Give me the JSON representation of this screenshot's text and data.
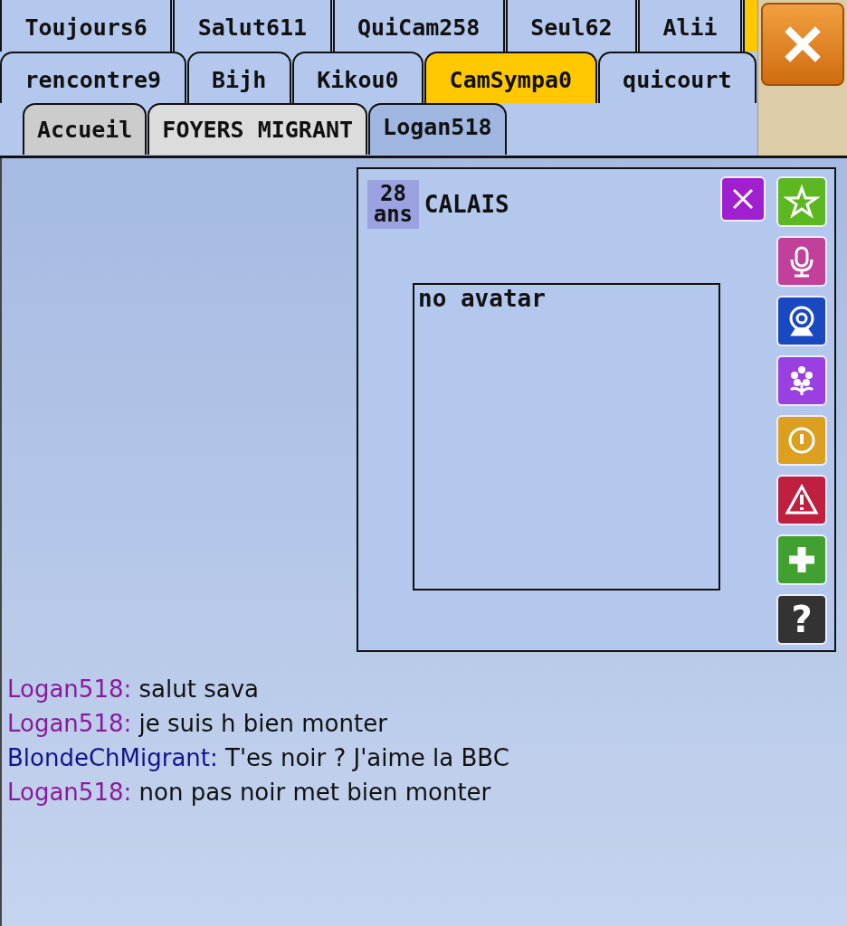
{
  "tab_rows": [
    {
      "tabs": [
        {
          "label": "Toujours6",
          "color": "#b4c8ee",
          "selected": false
        },
        {
          "label": "Salut611",
          "color": "#b4c8ee",
          "selected": false
        },
        {
          "label": "QuiCam258",
          "color": "#b4c8ee",
          "selected": false
        },
        {
          "label": "Seul62",
          "color": "#b4c8ee",
          "selected": false
        },
        {
          "label": "Alii",
          "color": "#b4c8ee",
          "selected": false
        }
      ]
    },
    {
      "tabs": [
        {
          "label": "rencontre9",
          "color": "#b4c8ee",
          "selected": false
        },
        {
          "label": "Bijh",
          "color": "#b4c8ee",
          "selected": false
        },
        {
          "label": "Kikou0",
          "color": "#b4c8ee",
          "selected": false
        },
        {
          "label": "CamSympa0",
          "color": "#ffc800",
          "selected": false
        },
        {
          "label": "quicourt",
          "color": "#b4c8ee",
          "selected": false
        }
      ]
    },
    {
      "tabs": [
        {
          "label": "Accueil",
          "color": "#cccccc",
          "selected": false
        },
        {
          "label": "FOYERS MIGRANT",
          "color": "#dcdcdc",
          "selected": false
        },
        {
          "label": "Logan518",
          "color": "#9fb6e0",
          "selected": true
        }
      ]
    }
  ],
  "profile": {
    "age": "28 ans",
    "city": "CALAIS",
    "avatar_text": "no avatar",
    "actions": [
      {
        "kind": "close"
      },
      {
        "kind": "star"
      },
      {
        "kind": "mic"
      },
      {
        "kind": "webcam"
      },
      {
        "kind": "flower"
      },
      {
        "kind": "info"
      },
      {
        "kind": "warning"
      },
      {
        "kind": "add"
      },
      {
        "kind": "help",
        "label": "?"
      }
    ]
  },
  "messages": [
    {
      "author": "Logan518:",
      "color": "#8a1a9a",
      "text": "salut sava"
    },
    {
      "author": "Logan518:",
      "color": "#8a1a9a",
      "text": "je suis h bien monter"
    },
    {
      "author": "BlondeChMigrant:",
      "color": "#14148a",
      "text": "T'es noir ? J'aime la BBC"
    },
    {
      "author": "Logan518:",
      "color": "#8a1a9a",
      "text": "non pas noir met bien monter"
    }
  ]
}
